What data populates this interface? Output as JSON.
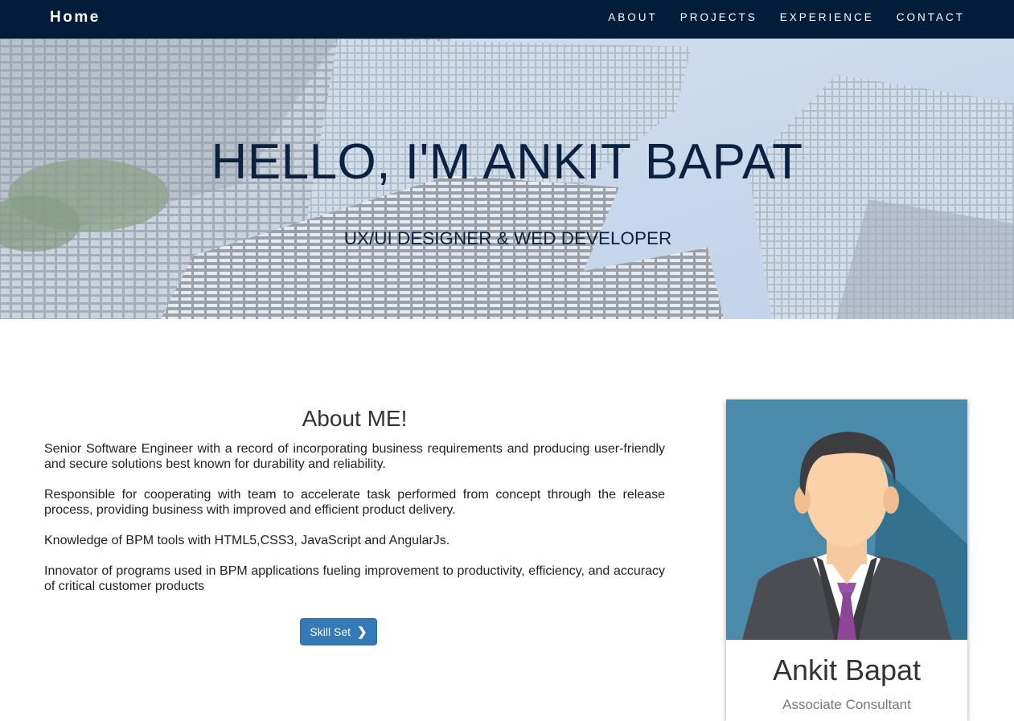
{
  "nav": {
    "brand": "Home",
    "links": [
      "ABOUT",
      "PROJECTS",
      "EXPERIENCE",
      "CONTACT"
    ]
  },
  "hero": {
    "title": "HELLO, I'M ANKIT BAPAT",
    "subtitle": "UX/UI DESIGNER & WED DEVELOPER"
  },
  "about": {
    "title": "About ME!",
    "paragraphs": [
      "Senior Software Engineer with a record of incorporating business requirements and producing user-friendly and secure solutions best known for durability and reliability.",
      "Responsible for cooperating with team to accelerate task performed from concept through the release process, providing business with improved and efficient product delivery.",
      "Knowledge of BPM tools with HTML5,CSS3, JavaScript and AngularJs.",
      "Innovator of programs used in BPM applications fueling improvement to productivity, efficiency, and accuracy of critical customer products"
    ],
    "button_label": "Skill Set",
    "button_icon": "chevron-right-icon"
  },
  "profile": {
    "name": "Ankit Bapat",
    "role": "Associate Consultant"
  },
  "colors": {
    "navbar": "#021c3a",
    "accent": "#337ab7",
    "hero_text": "#0b2140",
    "card_bg": "#3f86a6"
  }
}
